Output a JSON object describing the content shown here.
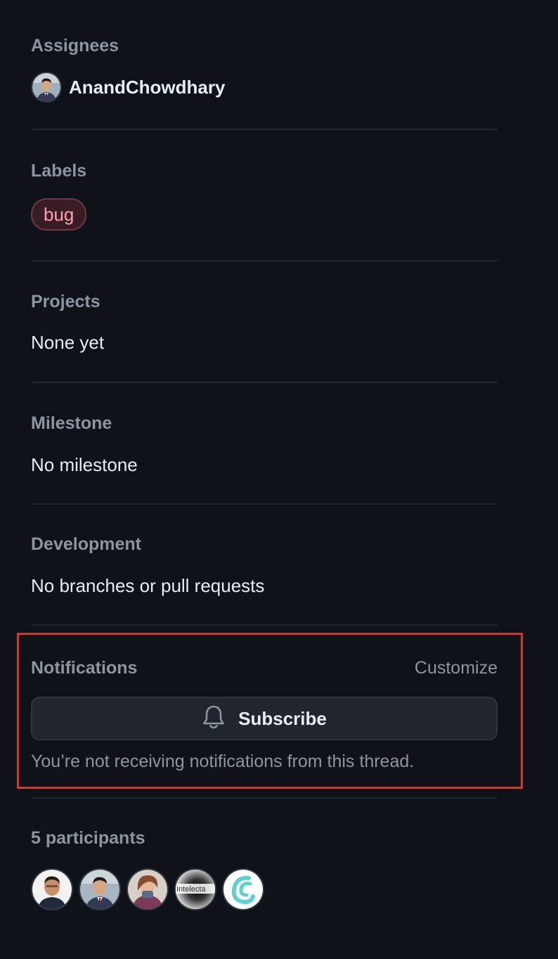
{
  "assignees": {
    "heading": "Assignees",
    "user": {
      "name": "AnandChowdhary",
      "avatar_icon": "user-avatar"
    }
  },
  "labels": {
    "heading": "Labels",
    "items": [
      {
        "name": "bug",
        "color": "#ff9fb0"
      }
    ]
  },
  "projects": {
    "heading": "Projects",
    "value": "None yet"
  },
  "milestone": {
    "heading": "Milestone",
    "value": "No milestone"
  },
  "development": {
    "heading": "Development",
    "value": "No branches or pull requests"
  },
  "notifications": {
    "heading": "Notifications",
    "customize_label": "Customize",
    "subscribe_label": "Subscribe",
    "subscribe_icon": "bell-icon",
    "status_text": "You’re not receiving notifications from this thread.",
    "highlight_color": "#d1392e"
  },
  "participants": {
    "heading": "5 participants",
    "avatars": [
      "participant-avatar-1",
      "participant-avatar-2",
      "participant-avatar-3",
      "participant-avatar-4",
      "participant-avatar-5"
    ],
    "avatar_4_text": "Intelecta"
  },
  "colors": {
    "background": "#0f1218",
    "muted_text": "#8d96a0",
    "primary_text": "#e6edf3"
  }
}
